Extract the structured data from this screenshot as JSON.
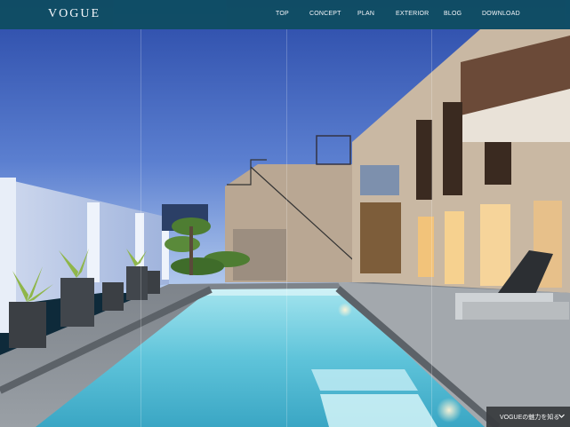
{
  "header": {
    "logo": "VOGUE",
    "nav": [
      "TOP",
      "CONCEPT",
      "PLAN",
      "EXTERIOR",
      "BLOG",
      "DOWNLOAD"
    ]
  },
  "promo": {
    "label": "VOGUEの魅力を知る",
    "icon": "chevron-down-icon"
  },
  "hero": {
    "description_icon": "photo",
    "colors": {
      "sky_top": "#2d4fb0",
      "sky_bottom": "#a9c3ec",
      "pool": "#7fd6e8",
      "deck": "#8a8f94",
      "header": "#0f4d63"
    }
  }
}
